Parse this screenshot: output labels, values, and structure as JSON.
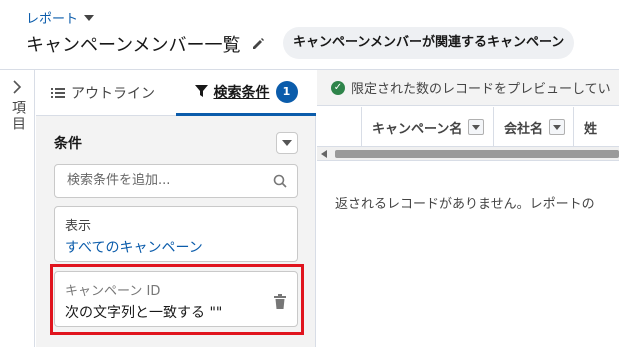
{
  "header": {
    "breadcrumb": "レポート",
    "title": "キャンペーンメンバー一覧",
    "report_type": "キャンペーンメンバーが関連するキャンペーン"
  },
  "rail": {
    "label": "項目"
  },
  "panel": {
    "tabs": [
      {
        "label": "アウトライン",
        "icon": "list-icon"
      },
      {
        "label": "検索条件",
        "icon": "funnel-icon",
        "count": "1"
      }
    ],
    "section_title": "条件",
    "search_placeholder": "検索条件を追加...",
    "filters": [
      {
        "label": "表示",
        "value": "すべてのキャンペーン"
      },
      {
        "label": "キャンペーン ID",
        "value": "次の文字列と一致する \"\""
      }
    ]
  },
  "preview": {
    "notice": "限定された数のレコードをプレビューしてい",
    "columns": [
      "キャンペーン名",
      "会社名",
      "姓"
    ],
    "empty_message": "返されるレコードがありません。レポートの"
  },
  "colors": {
    "accent": "#0b5cab",
    "highlight": "#e0141e",
    "success": "#2e844a"
  }
}
